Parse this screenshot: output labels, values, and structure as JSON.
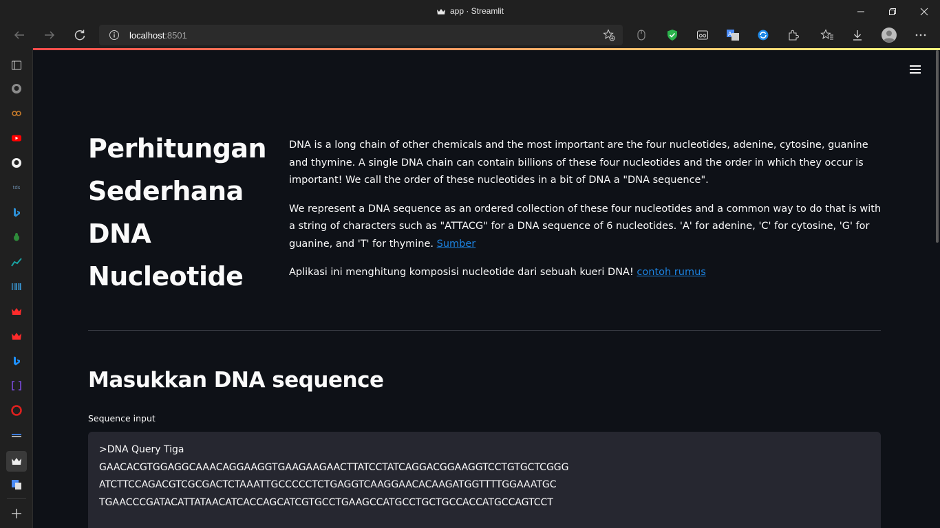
{
  "window": {
    "title": "app · Streamlit"
  },
  "browser": {
    "url_host": "localhost",
    "url_port": ":8501"
  },
  "page": {
    "title_lines": [
      "Perhitungan",
      "Sederhana",
      "DNA",
      "Nucleotide"
    ],
    "paragraph1": "DNA is a long chain of other chemicals and the most important are the four nucleotides, adenine, cytosine, guanine and thymine. A single DNA chain can contain billions of these four nucleotides and the order in which they occur is important! We call the order of these nucleotides in a bit of DNA a \"DNA sequence\".",
    "paragraph2": "We represent a DNA sequence as an ordered collection of these four nucleotides and a common way to do that is with a string of characters such as \"ATTACG\" for a DNA sequence of 6 nucleotides. 'A' for adenine, 'C' for cytosine, 'G' for guanine, and 'T' for thymine.",
    "paragraph2_link": "Sumber",
    "paragraph3": "Aplikasi ini menghitung komposisi nucleotide dari sebuah kueri DNA!",
    "paragraph3_link": "contoh rumus",
    "section_heading": "Masukkan DNA sequence",
    "input_label": "Sequence input",
    "input_lines": [
      ">DNA Query Tiga",
      "GAACACGTGGAGGCAAACAGGAAGGTGAAGAAGAACTTATCCTATCAGGACGGAAGGTCCTGTGCTCGGG",
      "ATCTTCCAGACGTCGCGACTCTAAATTGCCCCCTCTGAGGTCAAGGAACACAAGATGGTTTTGGAAATGC",
      "TGAACCCGATACATTATAACATCACCAGCATCGTGCCTGAAGCCATGCCTGCTGCCACCATGCCAGTCCT"
    ]
  },
  "colors": {
    "main_bg": "#0e1117",
    "link": "#1c83e1",
    "input_bg": "#262730"
  }
}
